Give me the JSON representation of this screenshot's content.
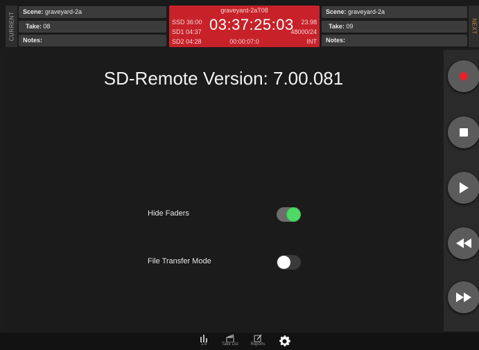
{
  "current": {
    "tab_label": "CURRENT",
    "scene_label": "Scene:",
    "scene_value": "graveyard-2a",
    "take_label": "Take:",
    "take_value": "08",
    "notes_label": "Notes:"
  },
  "next": {
    "tab_label": "NEXT",
    "scene_label": "Scene:",
    "scene_value": "graveyard-2a",
    "take_label": "Take:",
    "take_value": "09",
    "notes_label": "Notes:"
  },
  "timecode_panel": {
    "file_name": "graveyard-2aT08",
    "ssd": "SSD 36:00",
    "sd1": "SD1 04:37",
    "sd2": "SD2 04:28",
    "timecode": "03:37:25:03",
    "frame_rate": "23.98",
    "sample_rate": "48000/24",
    "elapsed": "00:00:07:0",
    "sync": "INT"
  },
  "settings": {
    "version_text": "SD-Remote Version: 7.00.081",
    "hide_faders_label": "Hide Faders",
    "hide_faders_on": true,
    "file_transfer_label": "File Transfer Mode",
    "file_transfer_on": false
  },
  "transport": [
    {
      "name": "record",
      "icon": "record-icon",
      "color": "#e8222a"
    },
    {
      "name": "stop",
      "icon": "stop-icon"
    },
    {
      "name": "play",
      "icon": "play-icon"
    },
    {
      "name": "rewind",
      "icon": "rewind-icon"
    },
    {
      "name": "fast-forward",
      "icon": "fast-forward-icon"
    }
  ],
  "bottom_tabs": [
    {
      "label": "1-8",
      "icon": "mixer-icon"
    },
    {
      "label": "Take List",
      "icon": "clapper-icon"
    },
    {
      "label": "Reports",
      "icon": "edit-icon"
    },
    {
      "label": "",
      "icon": "gear-icon",
      "active": true
    }
  ]
}
